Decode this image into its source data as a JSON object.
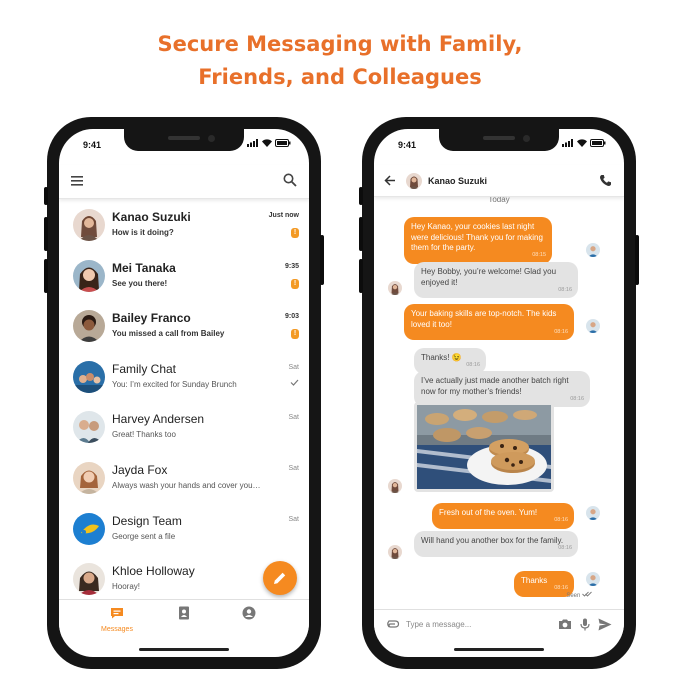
{
  "headline": {
    "line1": "Secure Messaging with Family,",
    "line2": "Friends, and Colleagues"
  },
  "colors": {
    "accent": "#e8702a",
    "bubble_out": "#f58a20",
    "bubble_in": "#e3e3e3"
  },
  "left_phone": {
    "status_time": "9:41",
    "icons": {
      "menu": "hamburger-icon",
      "search": "search-icon"
    },
    "conversations": [
      {
        "name": "Kanao Suzuki",
        "preview": "How is it doing?",
        "time": "Just now",
        "unread": true,
        "badge": "!"
      },
      {
        "name": "Mei Tanaka",
        "preview": "See you there!",
        "time": "9:35",
        "unread": true,
        "badge": "!"
      },
      {
        "name": "Bailey Franco",
        "preview": "You missed a call from Bailey",
        "time": "9:03",
        "unread": true,
        "badge": "!"
      },
      {
        "name": "Family Chat",
        "preview": "You: I’m excited for Sunday Brunch",
        "time": "Sat",
        "unread": false
      },
      {
        "name": "Harvey Andersen",
        "preview": "Great! Thanks too",
        "time": "Sat",
        "unread": false
      },
      {
        "name": "Jayda Fox",
        "preview": "Always wash your hands and cover your…",
        "time": "Sat",
        "unread": false
      },
      {
        "name": "Design Team",
        "preview": "George sent a file",
        "time": "Sat",
        "unread": false
      },
      {
        "name": "Khloe Holloway",
        "preview": "Hooray!",
        "time": "",
        "unread": false
      }
    ],
    "bottom_nav": {
      "messages_label": "Messages"
    }
  },
  "right_phone": {
    "status_time": "9:41",
    "contact_name": "Kanao Suzuki",
    "today_label": "Today",
    "messages": [
      {
        "dir": "out",
        "text": "Hey Kanao, your cookies last night were delicious! Thank you for making them for the party.",
        "time": "08:15"
      },
      {
        "dir": "in",
        "text": "Hey Bobby, you’re welcome! Glad you enjoyed it!",
        "time": "08:16"
      },
      {
        "dir": "out",
        "text": "Your baking skills are top-notch. The kids loved it too!",
        "time": "08:16"
      },
      {
        "dir": "in",
        "text": "Thanks! 😉",
        "time": "08:16"
      },
      {
        "dir": "in",
        "text": "I’ve actually just made another batch right now for my mother’s friends!",
        "time": "08:16"
      },
      {
        "dir": "out",
        "text": "Fresh out of the oven. Yum!",
        "time": "08:16"
      },
      {
        "dir": "in",
        "text": "Will hand you another box for the family.",
        "time": "08:16"
      },
      {
        "dir": "out",
        "text": "Thanks",
        "time": "08:16"
      }
    ],
    "seen_label": "Seen",
    "composer_placeholder": "Type a message..."
  }
}
